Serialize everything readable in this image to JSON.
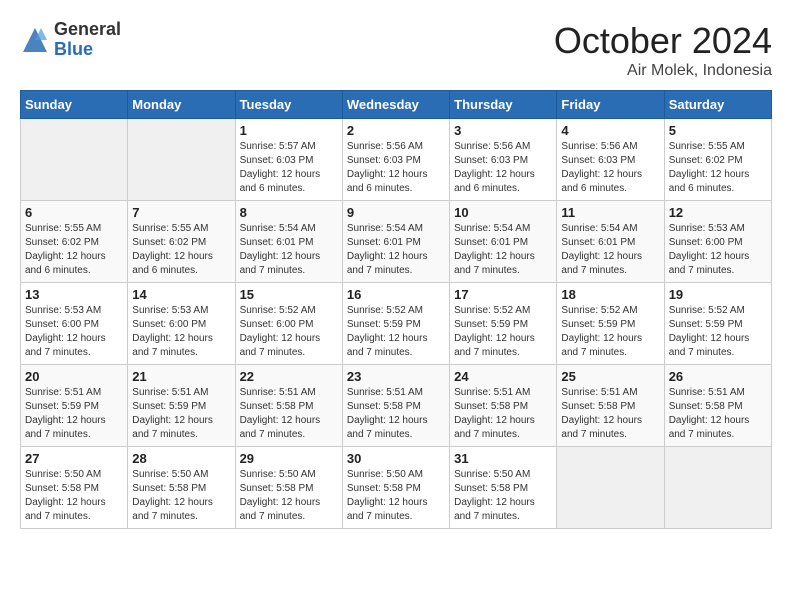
{
  "app": {
    "logo_general": "General",
    "logo_blue": "Blue",
    "month_title": "October 2024",
    "location": "Air Molek, Indonesia"
  },
  "calendar": {
    "headers": [
      "Sunday",
      "Monday",
      "Tuesday",
      "Wednesday",
      "Thursday",
      "Friday",
      "Saturday"
    ],
    "rows": [
      [
        {
          "day": "",
          "empty": true
        },
        {
          "day": "",
          "empty": true
        },
        {
          "day": "1",
          "info": "Sunrise: 5:57 AM\nSunset: 6:03 PM\nDaylight: 12 hours\nand 6 minutes."
        },
        {
          "day": "2",
          "info": "Sunrise: 5:56 AM\nSunset: 6:03 PM\nDaylight: 12 hours\nand 6 minutes."
        },
        {
          "day": "3",
          "info": "Sunrise: 5:56 AM\nSunset: 6:03 PM\nDaylight: 12 hours\nand 6 minutes."
        },
        {
          "day": "4",
          "info": "Sunrise: 5:56 AM\nSunset: 6:03 PM\nDaylight: 12 hours\nand 6 minutes."
        },
        {
          "day": "5",
          "info": "Sunrise: 5:55 AM\nSunset: 6:02 PM\nDaylight: 12 hours\nand 6 minutes."
        }
      ],
      [
        {
          "day": "6",
          "info": "Sunrise: 5:55 AM\nSunset: 6:02 PM\nDaylight: 12 hours\nand 6 minutes."
        },
        {
          "day": "7",
          "info": "Sunrise: 5:55 AM\nSunset: 6:02 PM\nDaylight: 12 hours\nand 6 minutes."
        },
        {
          "day": "8",
          "info": "Sunrise: 5:54 AM\nSunset: 6:01 PM\nDaylight: 12 hours\nand 7 minutes."
        },
        {
          "day": "9",
          "info": "Sunrise: 5:54 AM\nSunset: 6:01 PM\nDaylight: 12 hours\nand 7 minutes."
        },
        {
          "day": "10",
          "info": "Sunrise: 5:54 AM\nSunset: 6:01 PM\nDaylight: 12 hours\nand 7 minutes."
        },
        {
          "day": "11",
          "info": "Sunrise: 5:54 AM\nSunset: 6:01 PM\nDaylight: 12 hours\nand 7 minutes."
        },
        {
          "day": "12",
          "info": "Sunrise: 5:53 AM\nSunset: 6:00 PM\nDaylight: 12 hours\nand 7 minutes."
        }
      ],
      [
        {
          "day": "13",
          "info": "Sunrise: 5:53 AM\nSunset: 6:00 PM\nDaylight: 12 hours\nand 7 minutes."
        },
        {
          "day": "14",
          "info": "Sunrise: 5:53 AM\nSunset: 6:00 PM\nDaylight: 12 hours\nand 7 minutes."
        },
        {
          "day": "15",
          "info": "Sunrise: 5:52 AM\nSunset: 6:00 PM\nDaylight: 12 hours\nand 7 minutes."
        },
        {
          "day": "16",
          "info": "Sunrise: 5:52 AM\nSunset: 5:59 PM\nDaylight: 12 hours\nand 7 minutes."
        },
        {
          "day": "17",
          "info": "Sunrise: 5:52 AM\nSunset: 5:59 PM\nDaylight: 12 hours\nand 7 minutes."
        },
        {
          "day": "18",
          "info": "Sunrise: 5:52 AM\nSunset: 5:59 PM\nDaylight: 12 hours\nand 7 minutes."
        },
        {
          "day": "19",
          "info": "Sunrise: 5:52 AM\nSunset: 5:59 PM\nDaylight: 12 hours\nand 7 minutes."
        }
      ],
      [
        {
          "day": "20",
          "info": "Sunrise: 5:51 AM\nSunset: 5:59 PM\nDaylight: 12 hours\nand 7 minutes."
        },
        {
          "day": "21",
          "info": "Sunrise: 5:51 AM\nSunset: 5:59 PM\nDaylight: 12 hours\nand 7 minutes."
        },
        {
          "day": "22",
          "info": "Sunrise: 5:51 AM\nSunset: 5:58 PM\nDaylight: 12 hours\nand 7 minutes."
        },
        {
          "day": "23",
          "info": "Sunrise: 5:51 AM\nSunset: 5:58 PM\nDaylight: 12 hours\nand 7 minutes."
        },
        {
          "day": "24",
          "info": "Sunrise: 5:51 AM\nSunset: 5:58 PM\nDaylight: 12 hours\nand 7 minutes."
        },
        {
          "day": "25",
          "info": "Sunrise: 5:51 AM\nSunset: 5:58 PM\nDaylight: 12 hours\nand 7 minutes."
        },
        {
          "day": "26",
          "info": "Sunrise: 5:51 AM\nSunset: 5:58 PM\nDaylight: 12 hours\nand 7 minutes."
        }
      ],
      [
        {
          "day": "27",
          "info": "Sunrise: 5:50 AM\nSunset: 5:58 PM\nDaylight: 12 hours\nand 7 minutes."
        },
        {
          "day": "28",
          "info": "Sunrise: 5:50 AM\nSunset: 5:58 PM\nDaylight: 12 hours\nand 7 minutes."
        },
        {
          "day": "29",
          "info": "Sunrise: 5:50 AM\nSunset: 5:58 PM\nDaylight: 12 hours\nand 7 minutes."
        },
        {
          "day": "30",
          "info": "Sunrise: 5:50 AM\nSunset: 5:58 PM\nDaylight: 12 hours\nand 7 minutes."
        },
        {
          "day": "31",
          "info": "Sunrise: 5:50 AM\nSunset: 5:58 PM\nDaylight: 12 hours\nand 7 minutes."
        },
        {
          "day": "",
          "empty": true
        },
        {
          "day": "",
          "empty": true
        }
      ]
    ]
  }
}
